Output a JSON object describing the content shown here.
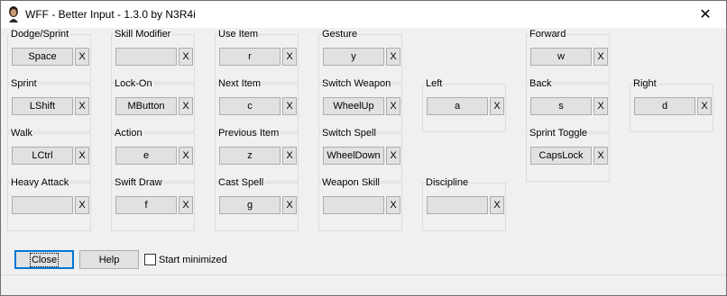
{
  "window": {
    "title": "WFF - Better Input - 1.3.0 by N3R4i",
    "close_glyph": "✕",
    "icon": "character-portrait-icon"
  },
  "bindings": [
    {
      "id": "dodge-sprint",
      "label": "Dodge/Sprint",
      "key": "Space"
    },
    {
      "id": "skill-modifier",
      "label": "Skill Modifier",
      "key": ""
    },
    {
      "id": "use-item",
      "label": "Use Item",
      "key": "r"
    },
    {
      "id": "gesture",
      "label": "Gesture",
      "key": "y"
    },
    {
      "id": "forward",
      "label": "Forward",
      "key": "w"
    },
    {
      "id": "sprint",
      "label": "Sprint",
      "key": "LShift"
    },
    {
      "id": "lock-on",
      "label": "Lock-On",
      "key": "MButton"
    },
    {
      "id": "next-item",
      "label": "Next Item",
      "key": "c"
    },
    {
      "id": "switch-weapon",
      "label": "Switch Weapon",
      "key": "WheelUp"
    },
    {
      "id": "left",
      "label": "Left",
      "key": "a"
    },
    {
      "id": "back",
      "label": "Back",
      "key": "s"
    },
    {
      "id": "right",
      "label": "Right",
      "key": "d"
    },
    {
      "id": "walk",
      "label": "Walk",
      "key": "LCtrl"
    },
    {
      "id": "action",
      "label": "Action",
      "key": "e"
    },
    {
      "id": "previous-item",
      "label": "Previous Item",
      "key": "z"
    },
    {
      "id": "switch-spell",
      "label": "Switch Spell",
      "key": "WheelDown"
    },
    {
      "id": "sprint-toggle",
      "label": "Sprint Toggle",
      "key": "CapsLock"
    },
    {
      "id": "heavy-attack",
      "label": "Heavy Attack",
      "key": ""
    },
    {
      "id": "swift-draw",
      "label": "Swift Draw",
      "key": "f"
    },
    {
      "id": "cast-spell",
      "label": "Cast Spell",
      "key": "g"
    },
    {
      "id": "weapon-skill",
      "label": "Weapon Skill",
      "key": ""
    },
    {
      "id": "discipline",
      "label": "Discipline",
      "key": ""
    }
  ],
  "clear_label": "X",
  "footer": {
    "close_label": "Close",
    "help_label": "Help",
    "start_minimized_label": "Start minimized",
    "start_minimized_checked": false
  }
}
